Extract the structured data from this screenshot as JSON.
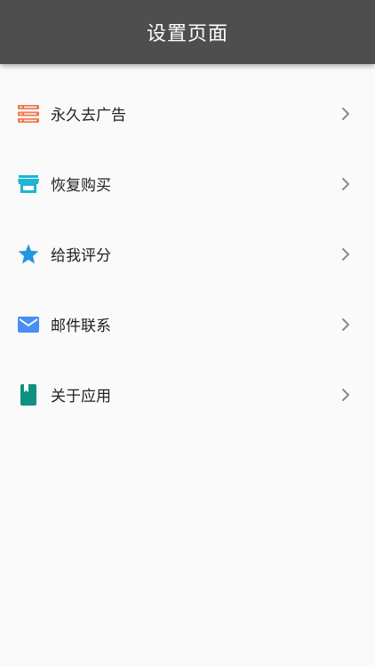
{
  "header": {
    "title": "设置页面",
    "background": "#4e4e4e"
  },
  "menu": {
    "items": [
      {
        "label": "永久去广告",
        "icon": "list-icon",
        "icon_color": "#ee7b52"
      },
      {
        "label": "恢复购买",
        "icon": "store-icon",
        "icon_color": "#1eb5d6"
      },
      {
        "label": "给我评分",
        "icon": "star-icon",
        "icon_color": "#2196e3"
      },
      {
        "label": "邮件联系",
        "icon": "mail-icon",
        "icon_color": "#4a8ef2"
      },
      {
        "label": "关于应用",
        "icon": "book-icon",
        "icon_color": "#10907e"
      }
    ],
    "chevron_icon": "chevron-right-icon",
    "chevron_color": "#8a8a8a"
  }
}
